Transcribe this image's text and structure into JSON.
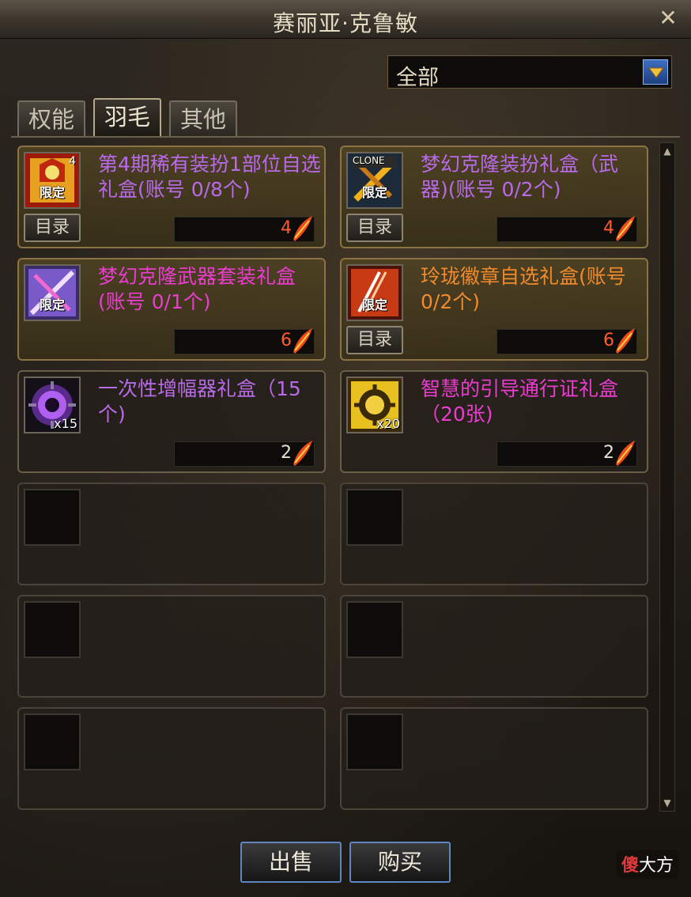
{
  "window": {
    "title": "赛丽亚·克鲁敏"
  },
  "filter": {
    "selected": "全部"
  },
  "tabs": [
    {
      "label": "权能",
      "active": false
    },
    {
      "label": "羽毛",
      "active": true
    },
    {
      "label": "其他",
      "active": false
    }
  ],
  "items": [
    {
      "name": "第4期稀有装扮1部位自选礼盒(账号 0/8个)",
      "icon": "costume-box-icon",
      "badge": "限定",
      "corner": "4",
      "catalog": "目录",
      "price": "4",
      "name_color": "#b86ae8"
    },
    {
      "name": "梦幻克隆装扮礼盒（武器)(账号 0/2个)",
      "icon": "clone-box-icon",
      "badge": "限定",
      "corner": "CLONE",
      "catalog": "目录",
      "price": "4",
      "name_color": "#b86ae8"
    },
    {
      "name": "梦幻克隆武器套装礼盒(账号 0/1个)",
      "icon": "weapon-set-icon",
      "badge": "限定",
      "price": "6",
      "name_color": "#ec3cd0"
    },
    {
      "name": "玲珑徽章自选礼盒(账号 0/2个)",
      "icon": "emblem-box-icon",
      "badge": "限定",
      "catalog": "目录",
      "price": "6",
      "name_color": "#f08a2c"
    },
    {
      "name": "一次性增幅器礼盒（15个)",
      "icon": "amplifier-icon",
      "count": "x15",
      "price": "2",
      "name_color": "#b86ae8"
    },
    {
      "name": "智慧的引导通行证礼盒（20张)",
      "icon": "pass-icon",
      "count": "x20",
      "price": "2",
      "name_color": "#ec3cd0"
    }
  ],
  "actions": {
    "sell": "出售",
    "buy": "购买"
  },
  "watermark": {
    "first": "傻",
    "rest": "大方"
  }
}
